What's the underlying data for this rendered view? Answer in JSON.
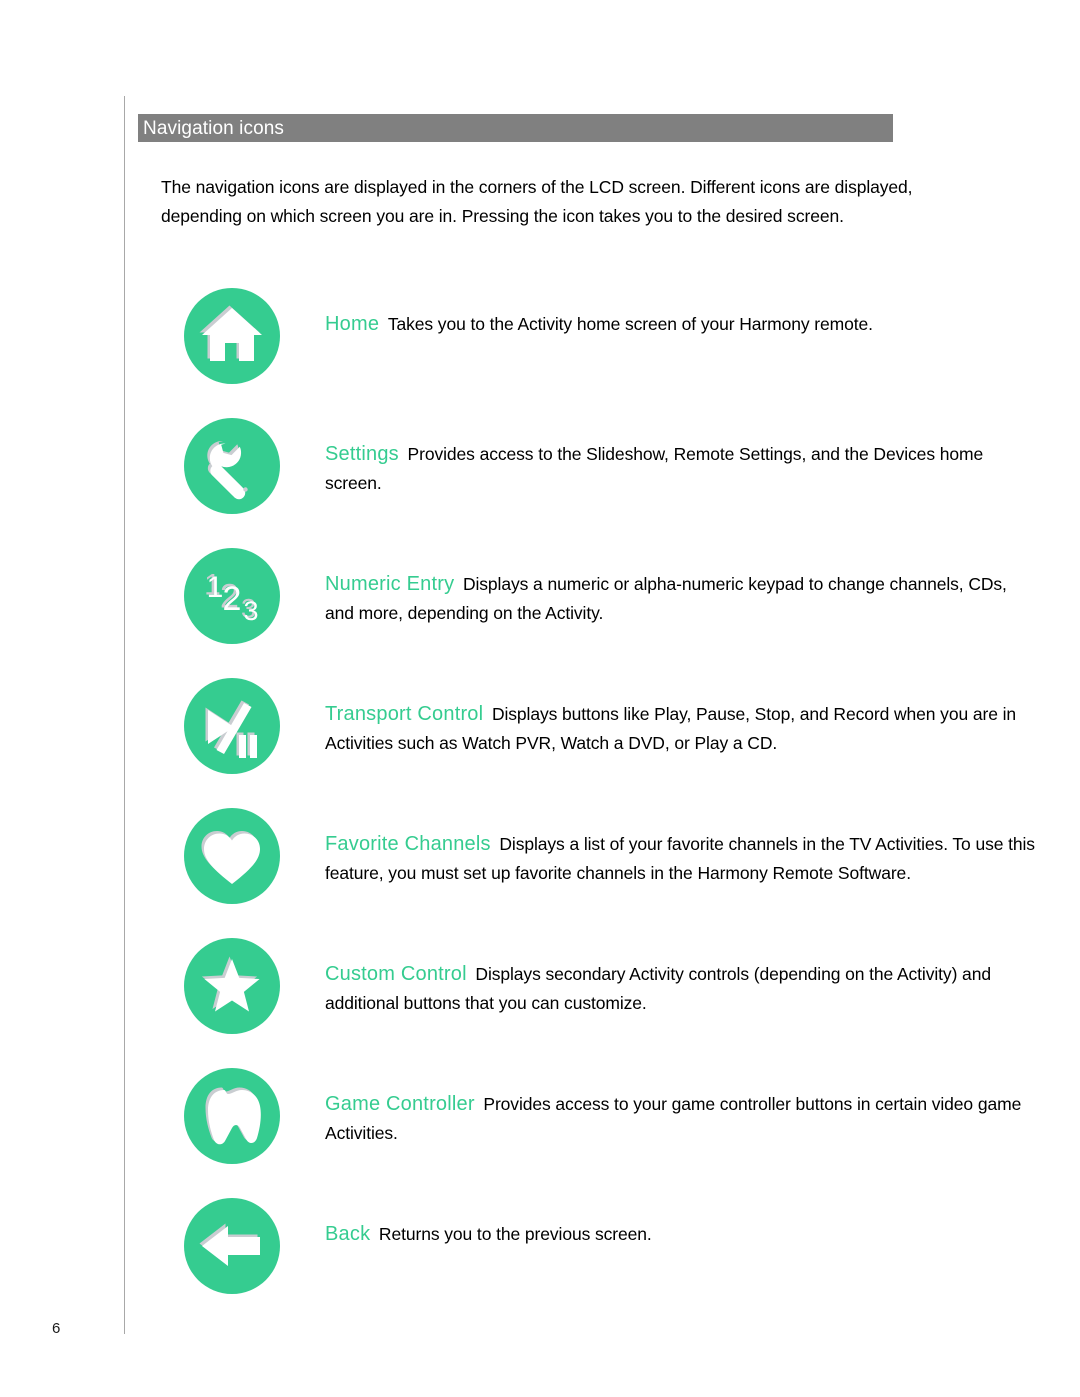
{
  "document": {
    "section_title": "Navigation icons",
    "intro": "The navigation icons are displayed in the corners of the LCD screen. Different icons are displayed, depending on which screen you are in. Pressing the icon takes you to the desired screen.",
    "page_number": "6"
  },
  "colors": {
    "icon_green": "#35cc90",
    "header_bar_gray": "#808080",
    "header_text": "#ffffff",
    "body_text": "#000000",
    "rule_gray": "#a8a8a8"
  },
  "entries": [
    {
      "icon": "home-icon",
      "term": "Home",
      "description": "Takes you to the Activity home screen of your Harmony remote."
    },
    {
      "icon": "wrench-settings-icon",
      "term": "Settings",
      "description": "Provides access to the Slideshow, Remote Settings, and the Devices home screen."
    },
    {
      "icon": "numeric-entry-123-icon",
      "term": "Numeric Entry",
      "description": "Displays a numeric or alpha-numeric keypad to change channels, CDs, and more, depending on the Activity."
    },
    {
      "icon": "play-pause-transport-icon",
      "term": "Transport Control",
      "description": "Displays buttons like Play, Pause, Stop, and Record when you are in Activities such as Watch PVR, Watch a DVD, or Play a CD."
    },
    {
      "icon": "heart-icon",
      "term": "Favorite Channels",
      "description": "Displays a list of your favorite channels in the TV Activities. To use this feature, you must set up favorite channels in the Harmony Remote Software."
    },
    {
      "icon": "star-icon",
      "term": "Custom Control",
      "description": "Displays secondary Activity controls (depending on the Activity) and additional buttons that you can customize."
    },
    {
      "icon": "game-controller-icon",
      "term": "Game Controller",
      "description": "Provides access to your game controller buttons in certain video game Activities."
    },
    {
      "icon": "back-arrow-icon",
      "term": "Back",
      "description": "Returns you to the previous screen."
    }
  ]
}
